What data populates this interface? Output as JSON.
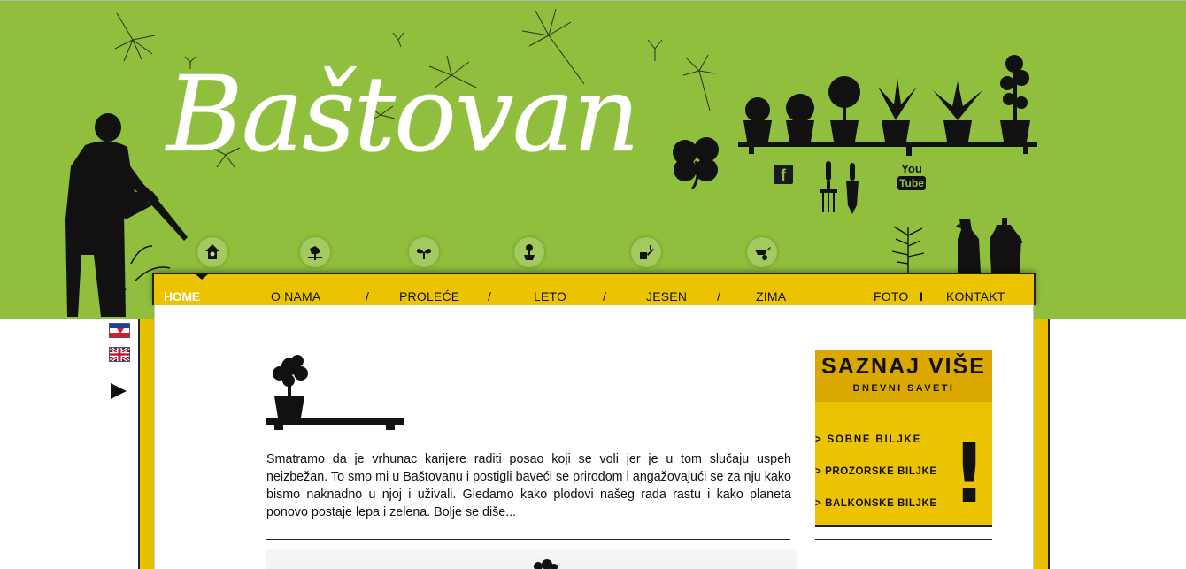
{
  "brand": {
    "logo_text": "Baštovan"
  },
  "social": {
    "facebook_glyph": "f",
    "youtube_top": "You",
    "youtube_bottom": "Tube"
  },
  "nav": {
    "items": [
      {
        "label": "HOME",
        "active": true
      },
      {
        "label": "O NAMA"
      },
      {
        "label": "PROLEĆE"
      },
      {
        "label": "LETO"
      },
      {
        "label": "JESEN"
      },
      {
        "label": "ZIMA"
      },
      {
        "label": "FOTO"
      },
      {
        "label": "KONTAKT"
      }
    ],
    "separator": "/",
    "separator_right": "I",
    "icons": [
      "birdhouse-icon",
      "rooster-weathervane-icon",
      "sprout-icon",
      "potted-flower-icon",
      "watering-tools-icon",
      "wheelbarrow-icon"
    ]
  },
  "main": {
    "intro": "Smatramo da je vrhunac karijere raditi posao koji se voli jer je u tom slučaju uspeh neizbežan. To smo mi u Baštovanu i postigli baveći se prirodom i angažovajući se za nju kako bismo naknadno u njoj i uživali. Gledamo kako plodovi našeg rada rastu i kako planeta ponovo postaje lepa i zelena. Bolje se diše..."
  },
  "sidebar": {
    "title": "SAZNAJ VIŠE",
    "subtitle": "DNEVNI SAVETI",
    "items": [
      {
        "label": "> SOBNE BILJKE"
      },
      {
        "label": "> PROZORSKE BILJKE"
      },
      {
        "label": "> BALKONSKE BILJKE"
      }
    ],
    "exclamation": "!"
  },
  "colors": {
    "header_green": "#8fbf3c",
    "nav_yellow": "#ecc300",
    "box_header": "#dba800",
    "text_dark": "#111111"
  }
}
